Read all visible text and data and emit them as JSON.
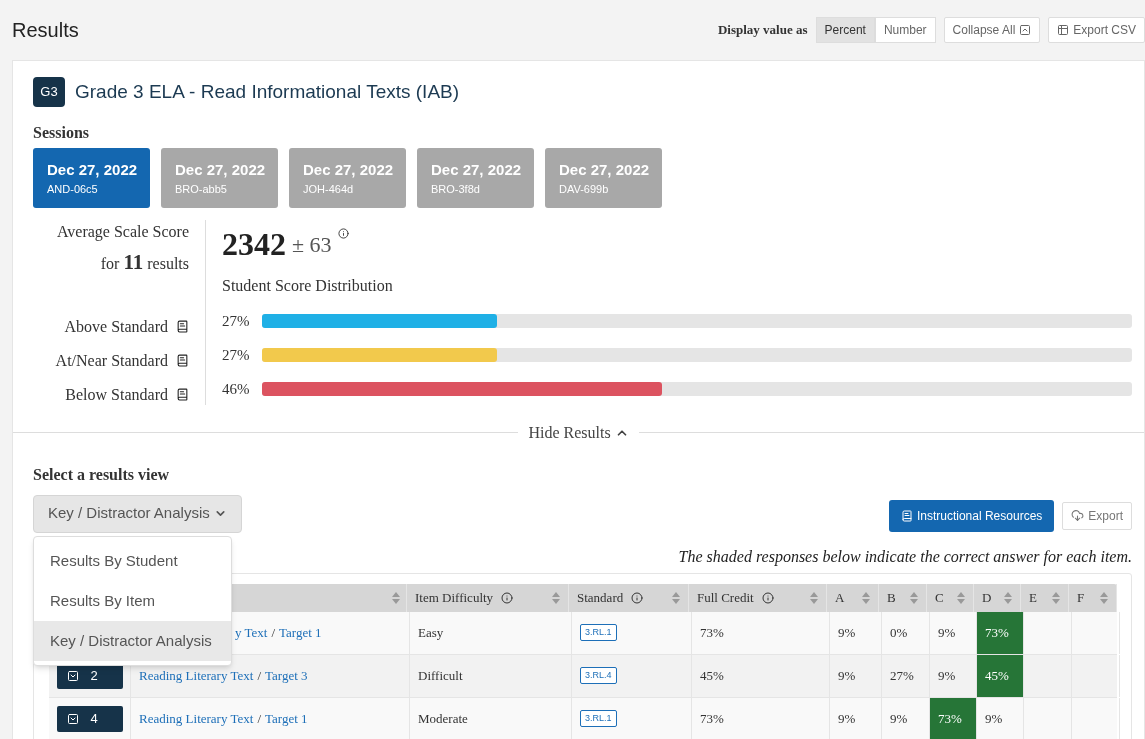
{
  "header": {
    "title": "Results",
    "display_label": "Display value as",
    "display_options": [
      {
        "label": "Percent",
        "selected": true
      },
      {
        "label": "Number",
        "selected": false
      }
    ],
    "collapse_button": "Collapse All",
    "export_csv_button": "Export CSV"
  },
  "assessment": {
    "badge": "G3",
    "title": "Grade 3 ELA - Read Informational Texts (IAB)"
  },
  "sessions": {
    "heading": "Sessions",
    "items": [
      {
        "date": "Dec 27, 2022",
        "code": "AND-06c5",
        "selected": true
      },
      {
        "date": "Dec 27, 2022",
        "code": "BRO-abb5",
        "selected": false
      },
      {
        "date": "Dec 27, 2022",
        "code": "JOH-464d",
        "selected": false
      },
      {
        "date": "Dec 27, 2022",
        "code": "BRO-3f8d",
        "selected": false
      },
      {
        "date": "Dec 27, 2022",
        "code": "DAV-699b",
        "selected": false
      }
    ]
  },
  "score": {
    "label": "Average Scale Score",
    "count_text": "for **11** results",
    "value": "2342",
    "error": "± 63",
    "distribution_title": "Student Score Distribution",
    "levels": [
      {
        "name": "Above Standard",
        "percent": "27%",
        "level": 0.27,
        "color": "#1fb0e6"
      },
      {
        "name": "At/Near Standard",
        "percent": "27%",
        "level": 0.27,
        "color": "#f2c94c"
      },
      {
        "name": "Below Standard",
        "percent": "46%",
        "level": 0.46,
        "color": "#dc5360"
      }
    ]
  },
  "hide_results": "Hide Results",
  "results_view": {
    "label": "Select a results view",
    "selected_value": "Key / Distractor Analysis",
    "menu": [
      {
        "label": "Results By Student",
        "selected": false
      },
      {
        "label": "Results By Item",
        "selected": false
      },
      {
        "label": "Key / Distractor Analysis",
        "selected": true
      }
    ]
  },
  "instructional_resources_button": "Instructional Resources",
  "export_button": "Export",
  "note": "The shaded responses below indicate the correct answer for each item.",
  "link_separator": "/",
  "table": {
    "columns": [
      "Item Difficulty",
      "Standard",
      "Full Credit",
      "A",
      "B",
      "C",
      "D",
      "E",
      "F"
    ],
    "rows": [
      {
        "claim": "y Text",
        "target": "Target 1",
        "difficulty": "Easy",
        "standard": "3.RL.1",
        "full_credit": "73%",
        "answers": [
          {
            "value": "9%",
            "correct": false
          },
          {
            "value": "0%",
            "correct": false
          },
          {
            "value": "9%",
            "correct": false
          },
          {
            "value": "73%",
            "correct": true
          },
          {
            "correct": false
          },
          {
            "correct": false
          }
        ]
      },
      {
        "number": "2",
        "claim": "Reading Literary Text",
        "target": "Target 3",
        "difficulty": "Difficult",
        "standard": "3.RL.4",
        "full_credit": "45%",
        "answers": [
          {
            "value": "9%",
            "correct": false
          },
          {
            "value": "27%",
            "correct": false
          },
          {
            "value": "9%",
            "correct": false
          },
          {
            "value": "45%",
            "correct": true
          },
          {
            "correct": false
          },
          {
            "correct": false
          }
        ]
      },
      {
        "number": "4",
        "claim": "Reading Literary Text",
        "target": "Target 1",
        "difficulty": "Moderate",
        "standard": "3.RL.1",
        "full_credit": "73%",
        "answers": [
          {
            "value": "9%",
            "correct": false
          },
          {
            "value": "9%",
            "correct": false
          },
          {
            "value": "73%",
            "correct": true
          },
          {
            "value": "9%",
            "correct": false
          },
          {
            "correct": false
          },
          {
            "correct": false
          }
        ]
      }
    ]
  }
}
